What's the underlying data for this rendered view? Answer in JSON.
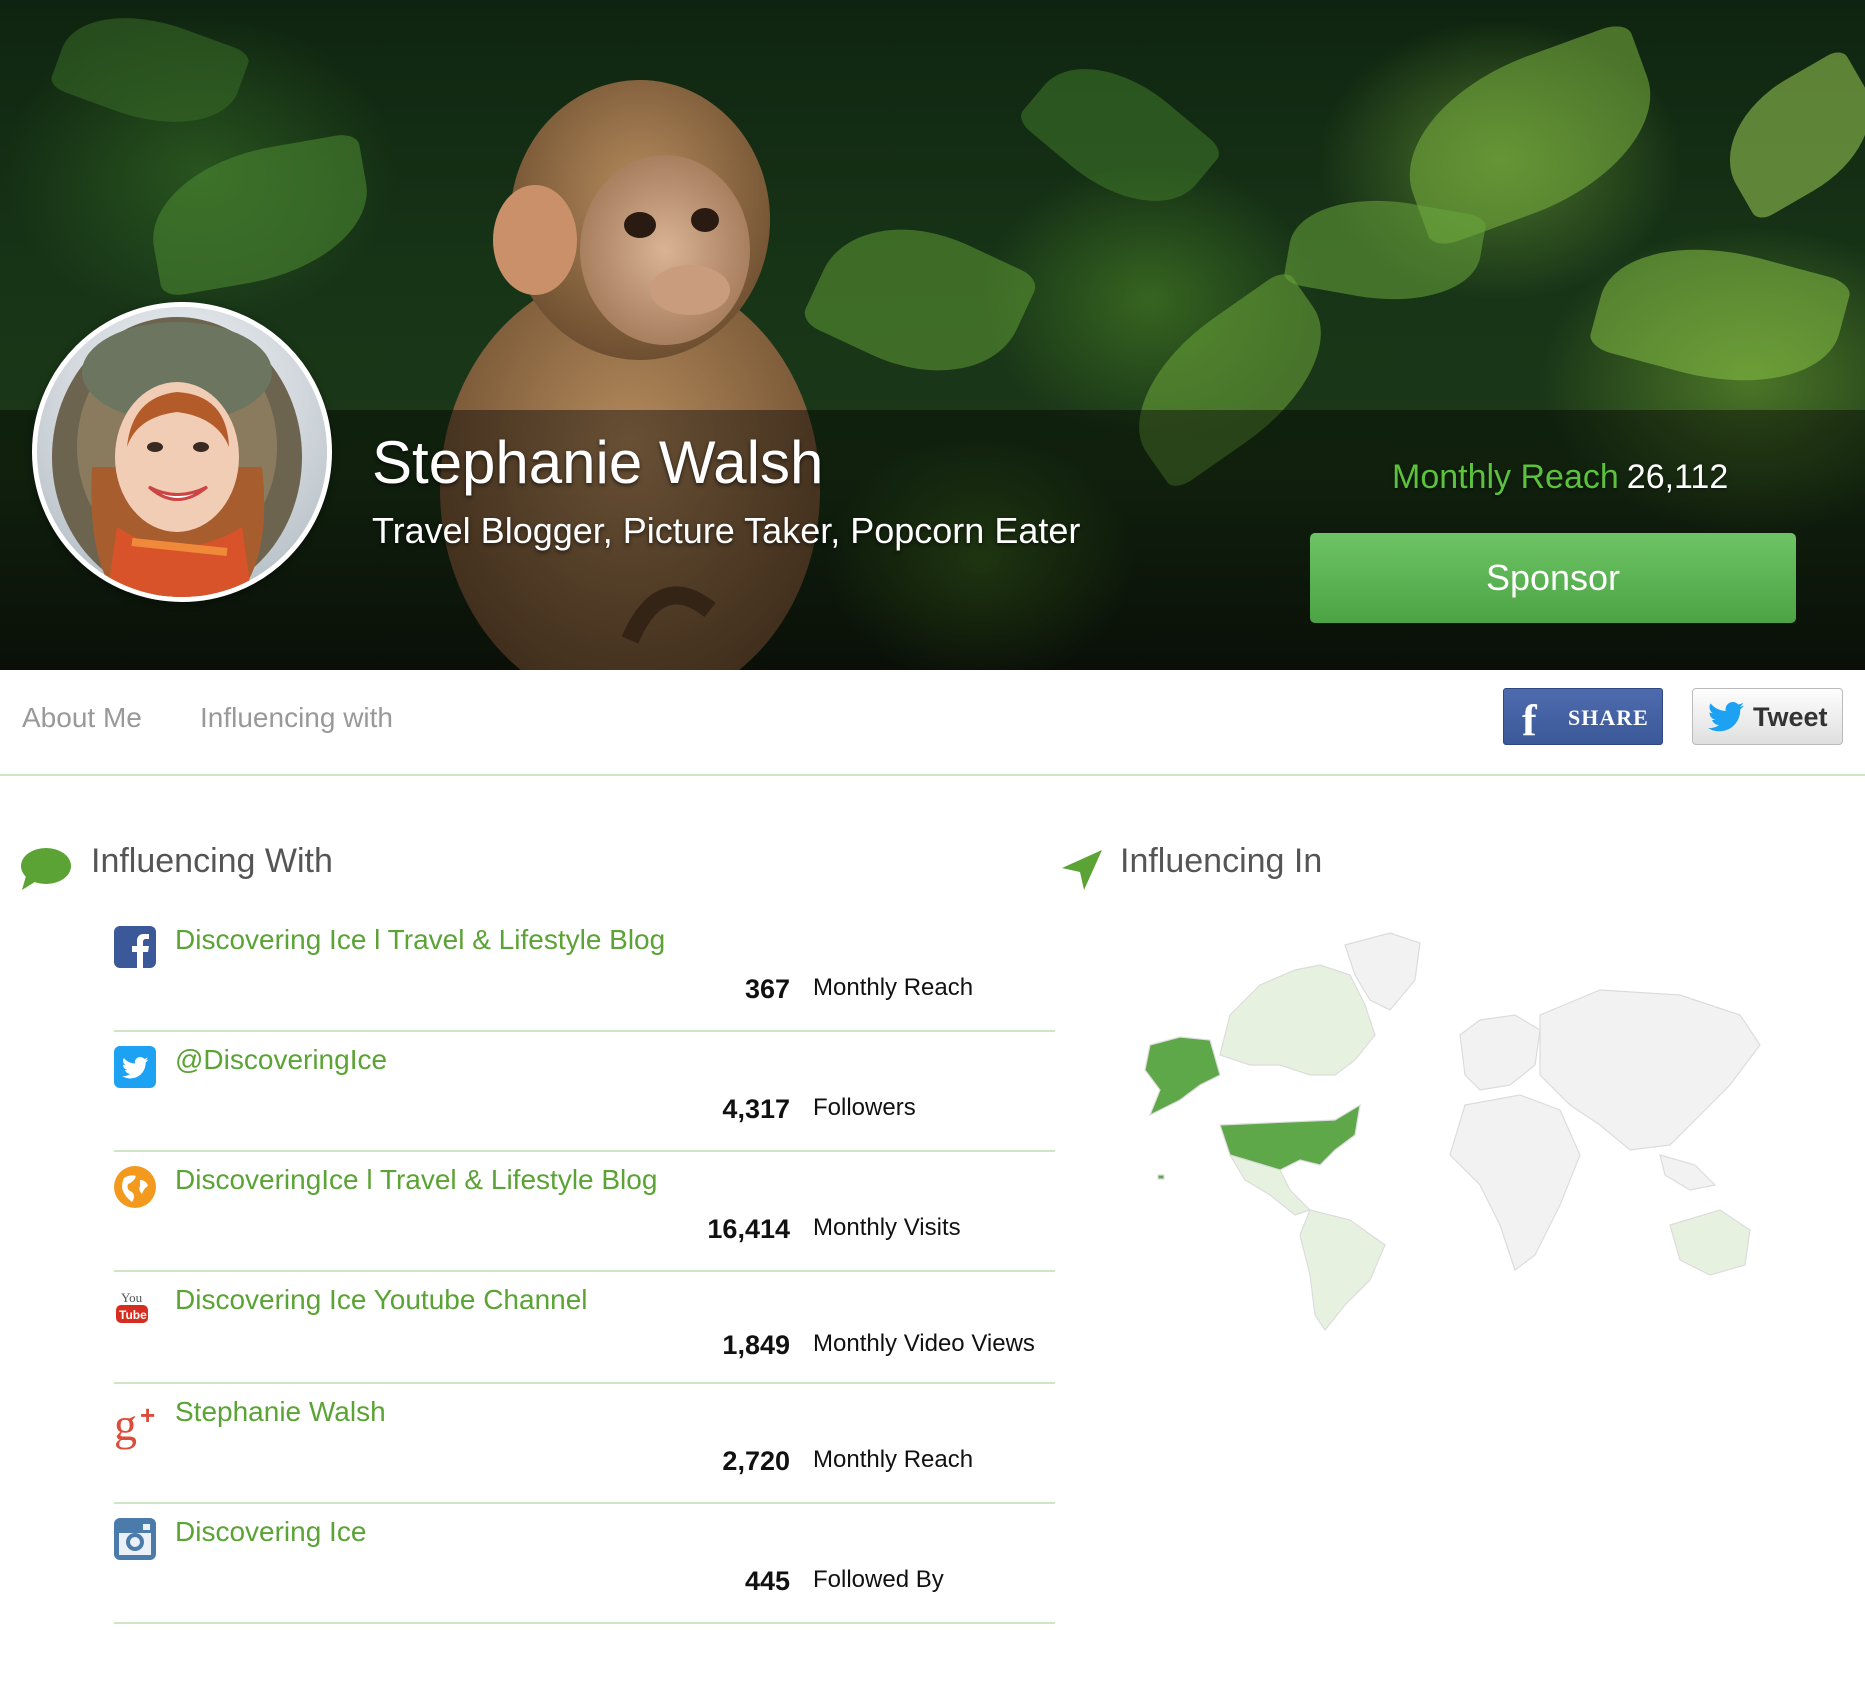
{
  "profile": {
    "name": "Stephanie Walsh",
    "tagline": "Travel Blogger, Picture Taker, Popcorn Eater",
    "reach_label": "Monthly Reach",
    "reach_value": "26,112",
    "sponsor_label": "Sponsor"
  },
  "nav": {
    "about": "About Me",
    "influencing": "Influencing with",
    "share_label": "SHARE",
    "tweet_label": "Tweet"
  },
  "influencing_with": {
    "title": "Influencing With",
    "items": [
      {
        "icon": "facebook-icon",
        "name": "Discovering Ice l Travel & Lifestyle Blog",
        "value": "367",
        "metric": "Monthly Reach"
      },
      {
        "icon": "twitter-icon",
        "name": "@DiscoveringIce",
        "value": "4,317",
        "metric": "Followers"
      },
      {
        "icon": "globe-icon",
        "name": "DiscoveringIce l Travel & Lifestyle Blog",
        "value": "16,414",
        "metric": "Monthly Visits"
      },
      {
        "icon": "youtube-icon",
        "name": "Discovering Ice Youtube Channel",
        "value": "1,849",
        "metric": "Monthly Video Views"
      },
      {
        "icon": "google-plus-icon",
        "name": "Stephanie Walsh",
        "value": "2,720",
        "metric": "Monthly Reach"
      },
      {
        "icon": "instagram-icon",
        "name": "Discovering Ice",
        "value": "445",
        "metric": "Followed By"
      }
    ]
  },
  "influencing_in": {
    "title": "Influencing In"
  },
  "colors": {
    "accent": "#5aa334",
    "reach_label": "#5cc13c",
    "sponsor": "#5cb553",
    "divider": "#cfe6c4",
    "map_strong": "#5fa84a",
    "map_light": "#e6f2df",
    "map_none": "#f2f2f2"
  }
}
